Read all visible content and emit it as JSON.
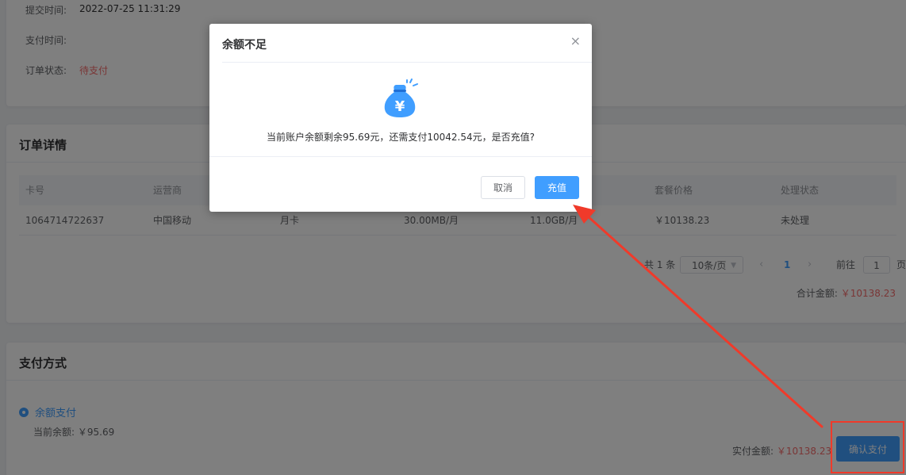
{
  "order_info": {
    "submit_time_label": "提交时间:",
    "submit_time_value": "2022-07-25 11:31:29",
    "pay_time_label": "支付时间:",
    "pay_time_value": "",
    "status_label": "订单状态:",
    "status_value": "待支付"
  },
  "order_detail": {
    "title": "订单详情",
    "columns": [
      "卡号",
      "运营商",
      "",
      "",
      "",
      "套餐价格",
      "处理状态"
    ],
    "rows": [
      [
        "1064714722637",
        "中国移动",
        "月卡",
        "30.00MB/月",
        "11.0GB/月",
        "￥10138.23",
        "未处理"
      ]
    ],
    "pagination": {
      "total_text": "共 1 条",
      "page_size": "10条/页",
      "prev": "‹",
      "current_page": "1",
      "next": "›",
      "goto_label": "前往",
      "goto_value": "1",
      "page_suffix": "页"
    },
    "total_label": "合计金额:",
    "total_value": "￥10138.23"
  },
  "payment": {
    "title": "支付方式",
    "method_label": "余额支付",
    "balance_label": "当前余额:",
    "balance_value": "￥95.69",
    "actual_label": "实付金额:",
    "actual_value": "￥10138.23",
    "confirm_button": "确认支付"
  },
  "dialog": {
    "title": "余额不足",
    "close": "×",
    "message": "当前账户余额剩余95.69元，还需支付10042.54元，是否充值?",
    "cancel_button": "取消",
    "ok_button": "充值",
    "icon": "money-bag-icon"
  },
  "colors": {
    "primary": "#409eff",
    "danger": "#f56c6c",
    "annotation": "#f03a2a"
  }
}
